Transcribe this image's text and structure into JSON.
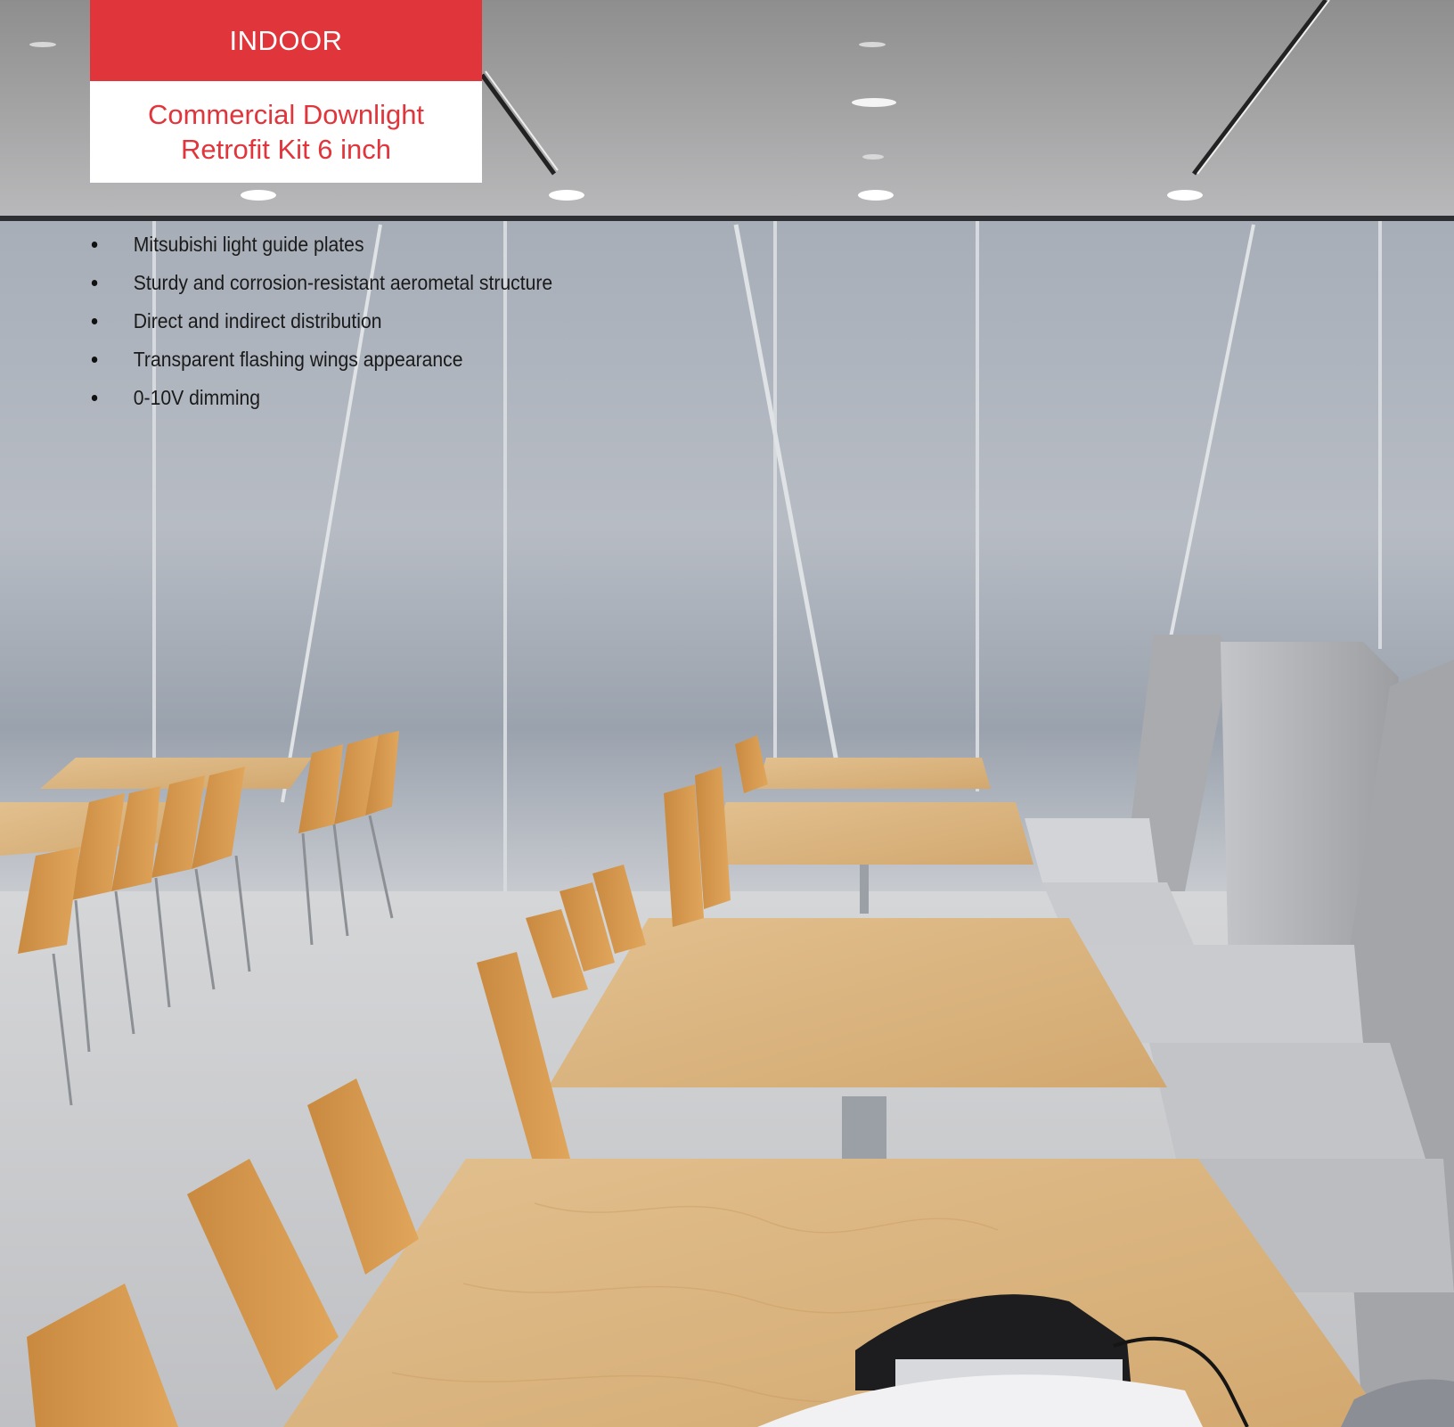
{
  "category_label": "INDOOR",
  "product_title_line1": "Commercial Downlight",
  "product_title_line2": "Retrofit Kit 6 inch",
  "features": [
    "Mitsubishi light guide plates",
    "Sturdy and corrosion-resistant aerometal structure",
    "Direct and indirect distribution",
    "Transparent flashing wings appearance",
    "0-10V dimming"
  ],
  "colors": {
    "accent": "#e0353b",
    "label_text_on_accent": "#ffffff",
    "body_text": "#1a1a1a"
  }
}
